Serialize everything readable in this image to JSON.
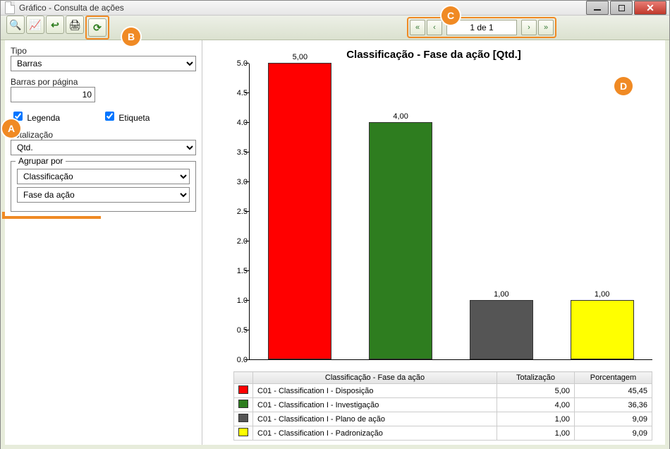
{
  "window": {
    "title": "Gráfico - Consulta de ações"
  },
  "toolbar": {
    "buttons": [
      {
        "name": "zoom-icon",
        "glyph": "🔍"
      },
      {
        "name": "chart-icon",
        "glyph": "📈"
      },
      {
        "name": "back-icon",
        "glyph": "↩"
      },
      {
        "name": "print-icon",
        "glyph": "🖨"
      },
      {
        "name": "refresh-icon",
        "glyph": "⟳"
      }
    ]
  },
  "pager": {
    "display": "1 de 1"
  },
  "sidebar": {
    "tipo_label": "Tipo",
    "tipo_value": "Barras",
    "barras_por_pagina_label": "Barras por página",
    "barras_por_pagina_value": "10",
    "legenda_label": "Legenda",
    "legenda_checked": true,
    "etiqueta_label": "Etiqueta",
    "etiqueta_checked": true,
    "totalizacao_label": "Totalização",
    "totalizacao_value": "Qtd.",
    "agrupar_por_label": "Agrupar por",
    "agrupar1_value": "Classificação",
    "agrupar2_value": "Fase da ação"
  },
  "chart_title": "Classificação - Fase da ação [Qtd.]",
  "chart_data": {
    "type": "bar",
    "title": "Classificação - Fase da ação [Qtd.]",
    "xlabel": "",
    "ylabel": "",
    "ylim": [
      0,
      5
    ],
    "ytick_step": 0.5,
    "categories": [
      "C01 - Classification I - Disposição",
      "C01 - Classification I - Investigação",
      "C01 - Classification I - Plano de ação",
      "C01 - Classification I - Padronização"
    ],
    "values": [
      5.0,
      4.0,
      1.0,
      1.0
    ],
    "value_labels": [
      "5,00",
      "4,00",
      "1,00",
      "1,00"
    ],
    "colors": [
      "#ff0000",
      "#2e7d1f",
      "#555555",
      "#ffff00"
    ]
  },
  "table": {
    "headers": [
      "Classificação - Fase da ação",
      "Totalização",
      "Porcentagem"
    ],
    "rows": [
      {
        "color": "#ff0000",
        "label": "C01 - Classification I - Disposição",
        "total": "5,00",
        "pct": "45,45"
      },
      {
        "color": "#2e7d1f",
        "label": "C01 - Classification I - Investigação",
        "total": "4,00",
        "pct": "36,36"
      },
      {
        "color": "#555555",
        "label": "C01 - Classification I - Plano de ação",
        "total": "1,00",
        "pct": "9,09"
      },
      {
        "color": "#ffff00",
        "label": "C01 - Classification I - Padronização",
        "total": "1,00",
        "pct": "9,09"
      }
    ]
  },
  "callouts": {
    "A": "A",
    "B": "B",
    "C": "C",
    "D": "D"
  }
}
